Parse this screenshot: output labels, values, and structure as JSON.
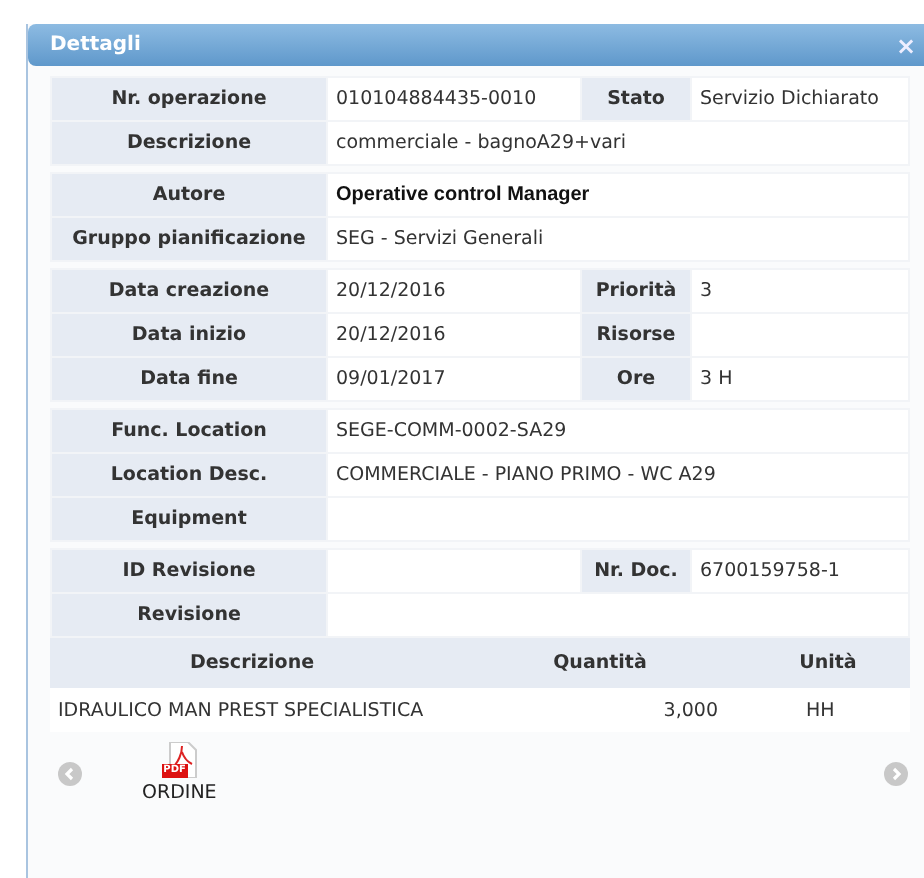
{
  "dialog": {
    "title": "Dettagli",
    "close": "×"
  },
  "groups": [
    {
      "rows": [
        {
          "label": "Nr. operazione",
          "value": "010104884435-0010",
          "label2": "Stato",
          "value2": "Servizio Dichiarato"
        },
        {
          "label": "Descrizione",
          "value": "commerciale - bagnoA29+vari"
        }
      ]
    },
    {
      "rows": [
        {
          "label": "Autore",
          "value": "Operative control Manager",
          "emphasis": true
        },
        {
          "label": "Gruppo pianificazione",
          "value": "SEG - Servizi Generali"
        }
      ]
    },
    {
      "rows": [
        {
          "label": "Data creazione",
          "value": "20/12/2016",
          "label2": "Priorità",
          "value2": "3"
        },
        {
          "label": "Data inizio",
          "value": "20/12/2016",
          "label2": "Risorse"
        },
        {
          "label": "Data fine",
          "value": "09/01/2017",
          "label2": "Ore",
          "value2": "3 H"
        }
      ]
    },
    {
      "rows": [
        {
          "label": "Func. Location",
          "value": "SEGE-COMM-0002-SA29"
        },
        {
          "label": "Location Desc.",
          "value": "COMMERCIALE - PIANO PRIMO - WC A29"
        },
        {
          "label": "Equipment"
        }
      ]
    },
    {
      "rows": [
        {
          "label": "ID Revisione",
          "label2": "Nr. Doc.",
          "value2": "6700159758-1"
        },
        {
          "label": "Revisione"
        }
      ]
    }
  ],
  "items": {
    "columns": [
      "Descrizione",
      "Quantità",
      "Unità"
    ],
    "rows": [
      [
        "IDRAULICO MAN PREST SPECIALISTICA",
        "3,000",
        "HH"
      ]
    ]
  },
  "attachments": [
    {
      "icon_label": "PDF",
      "name": "ORDINE"
    }
  ]
}
